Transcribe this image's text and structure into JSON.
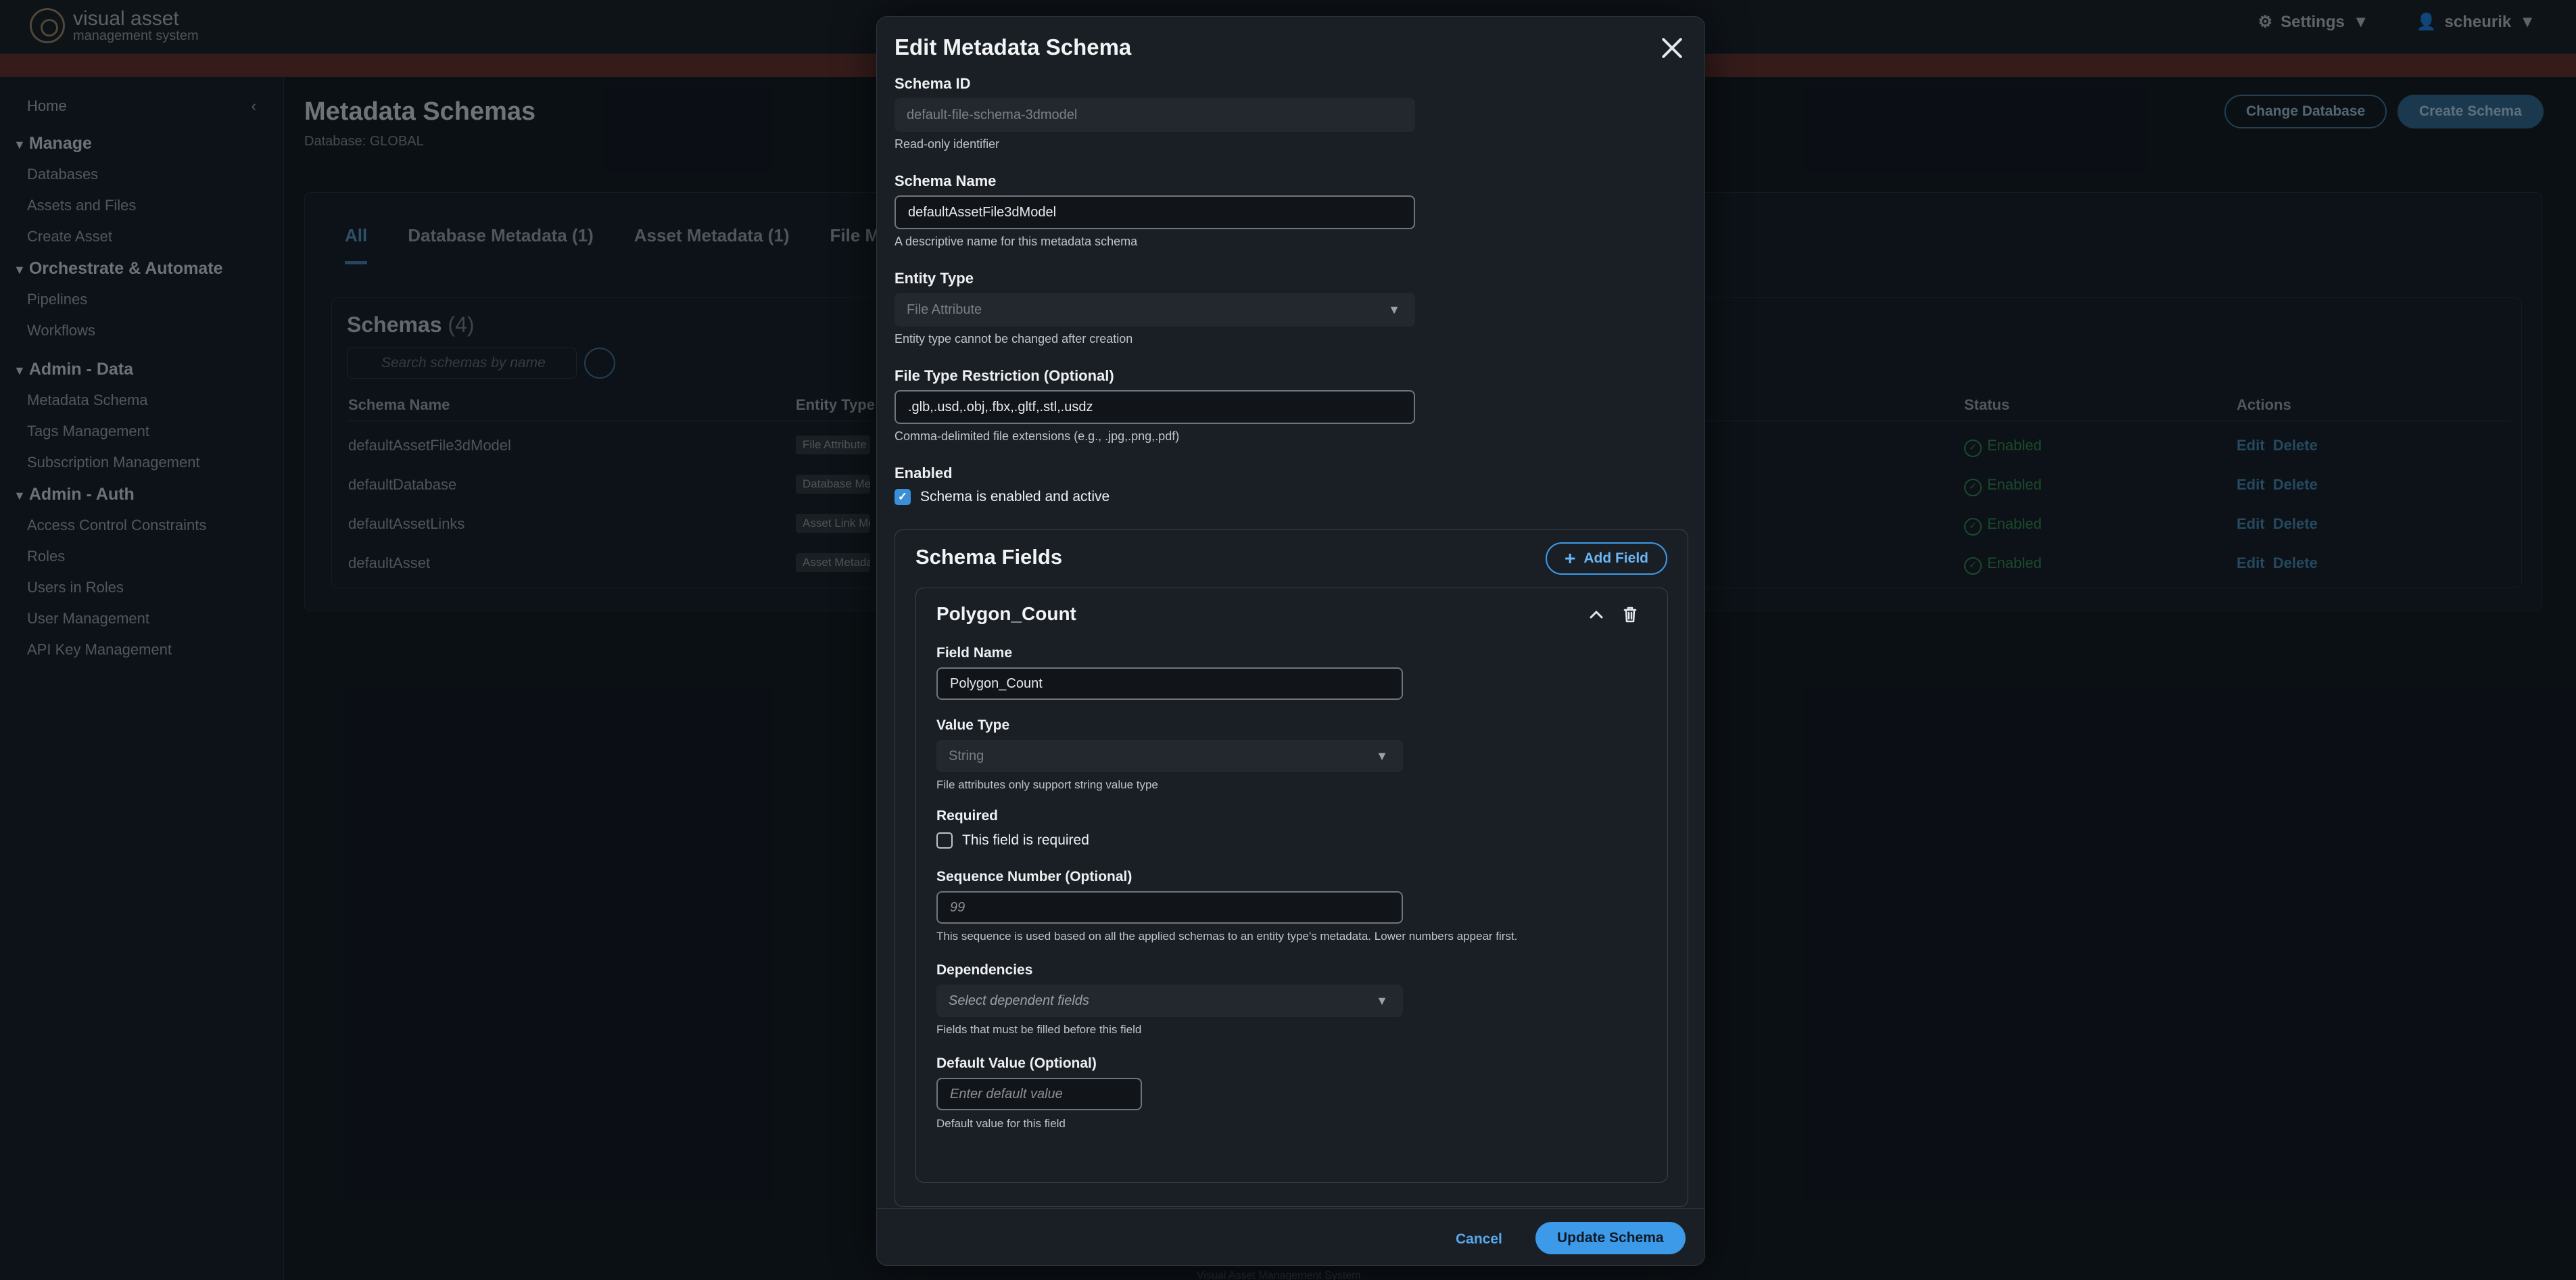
{
  "app": {
    "logo_line1": "visual asset",
    "logo_line2": "management system",
    "settings_label": "Settings",
    "user_label": "scheurik"
  },
  "sidebar": {
    "home": "Home",
    "sections": [
      {
        "title": "Manage",
        "items": [
          "Databases",
          "Assets and Files",
          "Create Asset"
        ]
      },
      {
        "title": "Orchestrate & Automate",
        "items": [
          "Pipelines",
          "Workflows"
        ]
      },
      {
        "title": "Admin - Data",
        "items": [
          "Metadata Schema",
          "Tags Management",
          "Subscription Management"
        ]
      },
      {
        "title": "Admin - Auth",
        "items": [
          "Access Control Constraints",
          "Roles",
          "Users in Roles",
          "User Management",
          "API Key Management"
        ]
      }
    ]
  },
  "page": {
    "title": "Metadata Schemas",
    "subtitle": "Database: GLOBAL",
    "change_db_label": "Change Database",
    "create_schema_label": "Create Schema",
    "tabs": [
      "All",
      "Database Metadata (1)",
      "Asset Metadata (1)",
      "File Meta"
    ],
    "schemas_title": "Schemas",
    "schemas_count": "(4)",
    "search_placeholder": "Search schemas by name",
    "columns": [
      "Schema Name",
      "Entity Type",
      "Status",
      "Actions"
    ],
    "rows": [
      {
        "name": "defaultAssetFile3dModel",
        "entity": "File Attribute",
        "status": "Enabled"
      },
      {
        "name": "defaultDatabase",
        "entity": "Database Metadata",
        "status": "Enabled"
      },
      {
        "name": "defaultAssetLinks",
        "entity": "Asset Link Metadata",
        "status": "Enabled"
      },
      {
        "name": "defaultAsset",
        "entity": "Asset Metadata",
        "status": "Enabled"
      }
    ],
    "edit_label": "Edit",
    "delete_label": "Delete",
    "footer": "Visual Asset Management System"
  },
  "modal": {
    "title": "Edit Metadata Schema",
    "schema_id_label": "Schema ID",
    "schema_id_value": "default-file-schema-3dmodel",
    "schema_id_help": "Read-only identifier",
    "schema_name_label": "Schema Name",
    "schema_name_value": "defaultAssetFile3dModel",
    "schema_name_help": "A descriptive name for this metadata schema",
    "entity_type_label": "Entity Type",
    "entity_type_value": "File Attribute",
    "entity_type_help": "Entity type cannot be changed after creation",
    "file_type_label": "File Type Restriction (Optional)",
    "file_type_value": ".glb,.usd,.obj,.fbx,.gltf,.stl,.usdz",
    "file_type_help": "Comma-delimited file extensions (e.g., .jpg,.png,.pdf)",
    "enabled_label": "Enabled",
    "enabled_checkbox_label": "Schema is enabled and active",
    "enabled_checked": true,
    "fields_title": "Schema Fields",
    "add_field_label": "Add Field",
    "field": {
      "title": "Polygon_Count",
      "field_name_label": "Field Name",
      "field_name_value": "Polygon_Count",
      "value_type_label": "Value Type",
      "value_type_value": "String",
      "value_type_help": "File attributes only support string value type",
      "required_label": "Required",
      "required_checkbox_label": "This field is required",
      "required_checked": false,
      "sequence_label": "Sequence Number (Optional)",
      "sequence_placeholder": "99",
      "sequence_help": "This sequence is used based on all the applied schemas to an entity type's metadata. Lower numbers appear first.",
      "dependencies_label": "Dependencies",
      "dependencies_placeholder": "Select dependent fields",
      "dependencies_help": "Fields that must be filled before this field",
      "default_label": "Default Value (Optional)",
      "default_placeholder": "Enter default value",
      "default_help": "Default value for this field"
    },
    "cancel_label": "Cancel",
    "update_label": "Update Schema"
  },
  "colors": {
    "accent": "#3d9ae8",
    "status_enabled": "#2e7d45",
    "banner": "#5c2a27"
  }
}
